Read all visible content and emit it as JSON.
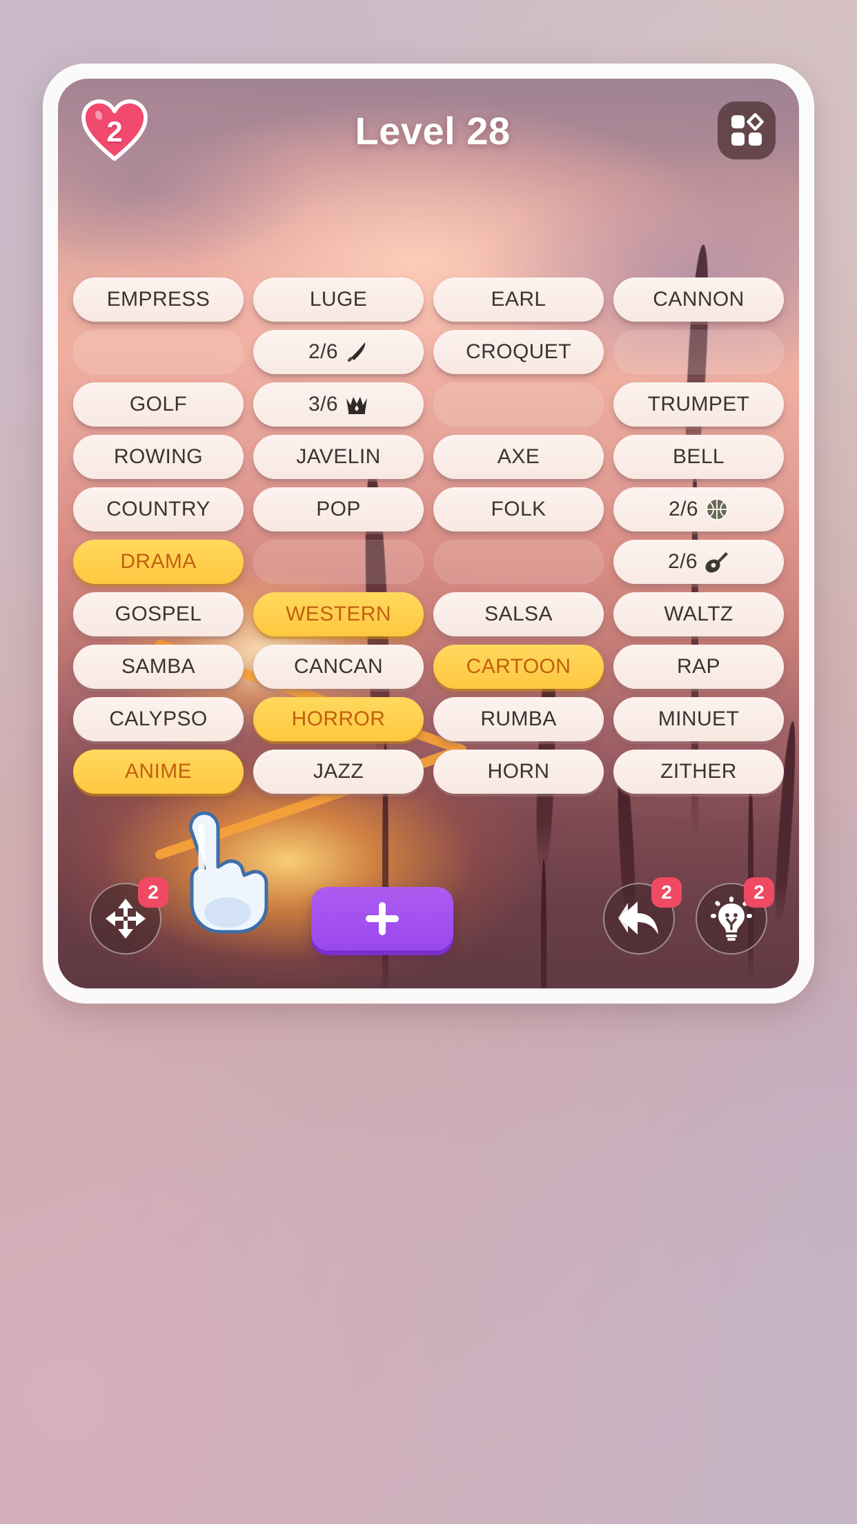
{
  "header": {
    "lives": "2",
    "title": "Level 28",
    "menu_icon": "grid-shapes-icon"
  },
  "colors": {
    "selected_tile_bg": "#ffd257",
    "selected_tile_text": "#c2600f",
    "tile_bg": "#fbefe9",
    "tile_text": "#3b3330",
    "badge_red": "#f04a63",
    "heart_pink": "#f2496f",
    "add_button_purple": "#a054ef",
    "connector_orange": "#f5a13a"
  },
  "board": {
    "rows": [
      [
        {
          "type": "word",
          "label": "EMPRESS",
          "state": "normal"
        },
        {
          "type": "word",
          "label": "LUGE",
          "state": "normal"
        },
        {
          "type": "word",
          "label": "EARL",
          "state": "normal"
        },
        {
          "type": "word",
          "label": "CANNON",
          "state": "normal"
        }
      ],
      [
        {
          "type": "empty",
          "label": "",
          "state": "empty"
        },
        {
          "type": "count",
          "label": "2/6",
          "icon": "knife-icon",
          "state": "normal"
        },
        {
          "type": "word",
          "label": "CROQUET",
          "state": "normal"
        },
        {
          "type": "empty",
          "label": "",
          "state": "empty"
        }
      ],
      [
        {
          "type": "word",
          "label": "GOLF",
          "state": "normal"
        },
        {
          "type": "count",
          "label": "3/6",
          "icon": "crown-icon",
          "state": "normal"
        },
        {
          "type": "empty",
          "label": "",
          "state": "empty"
        },
        {
          "type": "word",
          "label": "TRUMPET",
          "state": "normal"
        }
      ],
      [
        {
          "type": "word",
          "label": "ROWING",
          "state": "normal"
        },
        {
          "type": "word",
          "label": "JAVELIN",
          "state": "normal"
        },
        {
          "type": "word",
          "label": "AXE",
          "state": "normal"
        },
        {
          "type": "word",
          "label": "BELL",
          "state": "normal"
        }
      ],
      [
        {
          "type": "word",
          "label": "COUNTRY",
          "state": "normal"
        },
        {
          "type": "word",
          "label": "POP",
          "state": "normal"
        },
        {
          "type": "word",
          "label": "FOLK",
          "state": "normal"
        },
        {
          "type": "count",
          "label": "2/6",
          "icon": "basketball-icon",
          "state": "normal"
        }
      ],
      [
        {
          "type": "word",
          "label": "DRAMA",
          "state": "selected"
        },
        {
          "type": "empty",
          "label": "",
          "state": "empty"
        },
        {
          "type": "empty",
          "label": "",
          "state": "empty"
        },
        {
          "type": "count",
          "label": "2/6",
          "icon": "guitar-icon",
          "state": "normal"
        }
      ],
      [
        {
          "type": "word",
          "label": "GOSPEL",
          "state": "normal"
        },
        {
          "type": "word",
          "label": "WESTERN",
          "state": "selected"
        },
        {
          "type": "word",
          "label": "SALSA",
          "state": "normal"
        },
        {
          "type": "word",
          "label": "WALTZ",
          "state": "normal"
        }
      ],
      [
        {
          "type": "word",
          "label": "SAMBA",
          "state": "normal"
        },
        {
          "type": "word",
          "label": "CANCAN",
          "state": "normal"
        },
        {
          "type": "word",
          "label": "CARTOON",
          "state": "selected"
        },
        {
          "type": "word",
          "label": "RAP",
          "state": "normal"
        }
      ],
      [
        {
          "type": "word",
          "label": "CALYPSO",
          "state": "normal"
        },
        {
          "type": "word",
          "label": "HORROR",
          "state": "selected"
        },
        {
          "type": "word",
          "label": "RUMBA",
          "state": "normal"
        },
        {
          "type": "word",
          "label": "MINUET",
          "state": "normal"
        }
      ],
      [
        {
          "type": "word",
          "label": "ANIME",
          "state": "selected"
        },
        {
          "type": "word",
          "label": "JAZZ",
          "state": "normal"
        },
        {
          "type": "word",
          "label": "HORN",
          "state": "normal"
        },
        {
          "type": "word",
          "label": "ZITHER",
          "state": "normal"
        }
      ]
    ],
    "selection_path": [
      "DRAMA",
      "WESTERN",
      "CARTOON",
      "HORROR",
      "ANIME"
    ]
  },
  "toolbar": {
    "shuffle": {
      "icon": "four-arrows-icon",
      "badge": "2"
    },
    "add": {
      "icon": "plus-icon",
      "label": "+"
    },
    "undo": {
      "icon": "undo-arrow-icon",
      "badge": "2"
    },
    "hint": {
      "icon": "lightbulb-icon",
      "badge": "2"
    }
  },
  "cursor": {
    "icon": "pointing-hand-icon",
    "target": "ANIME"
  }
}
